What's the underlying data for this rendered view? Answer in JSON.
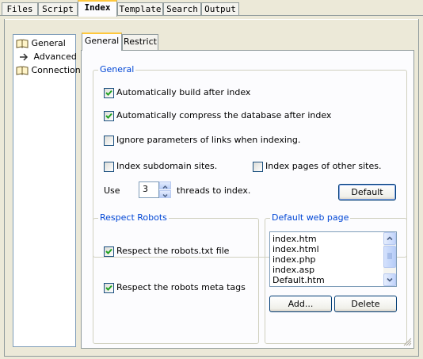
{
  "top_tabs": [
    {
      "label": "Files",
      "active": false
    },
    {
      "label": "Script",
      "active": false
    },
    {
      "label": "Index",
      "active": true
    },
    {
      "label": "Template",
      "active": false
    },
    {
      "label": "Search",
      "active": false
    },
    {
      "label": "Output",
      "active": false
    }
  ],
  "tree": {
    "items": [
      {
        "label": "General",
        "icon": "book-icon"
      },
      {
        "label": "Advanced",
        "icon": "arrow-right-icon"
      },
      {
        "label": "Connection",
        "icon": "book-icon"
      }
    ]
  },
  "inner_tabs": [
    {
      "label": "General",
      "active": true
    },
    {
      "label": "Restrict",
      "active": false
    }
  ],
  "general_group": {
    "title": "General",
    "auto_build": {
      "label": "Automatically build after index",
      "checked": true
    },
    "auto_compress": {
      "label": "Automatically compress the database after index",
      "checked": true
    },
    "ignore_params": {
      "label": "Ignore parameters of links when indexing.",
      "checked": false
    },
    "index_subdomain": {
      "label": "Index subdomain sites.",
      "checked": false
    },
    "index_other_sites": {
      "label": "Index pages of other sites.",
      "checked": false
    },
    "use_label": "Use",
    "threads_value": "3",
    "threads_label": "threads to index.",
    "default_button": "Default"
  },
  "robots_group": {
    "title": "Respect Robots",
    "robots_txt": {
      "label": "Respect the robots.txt file",
      "checked": true
    },
    "robots_meta": {
      "label": "Respect the robots meta tags",
      "checked": true
    }
  },
  "default_page_group": {
    "title": "Default web page",
    "items": [
      "index.htm",
      "index.html",
      "index.php",
      "index.asp",
      "Default.htm"
    ],
    "add_button": "Add...",
    "delete_button": "Delete"
  },
  "colors": {
    "face": "#ece9d8",
    "panel": "#fcfcfe",
    "tab_accent": "#ffc83c",
    "group_title": "#0046d5",
    "checkmark": "#21a121"
  }
}
